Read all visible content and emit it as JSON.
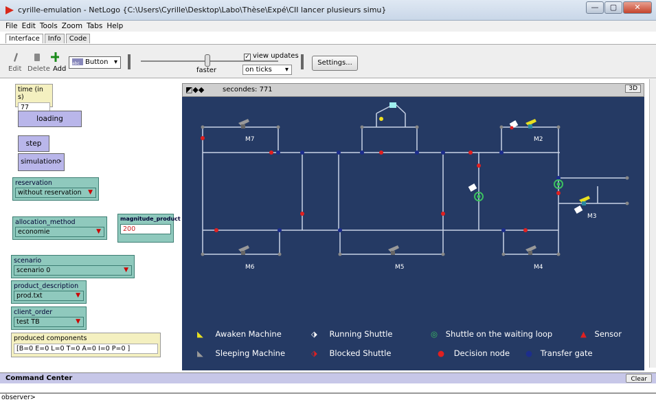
{
  "window": {
    "title": "cyrille-emulation - NetLogo {C:\\Users\\Cyrille\\Desktop\\Labo\\Thèse\\Expé\\CII lancer plusieurs simu}",
    "buttons": [
      "—",
      "▢",
      "✕"
    ]
  },
  "menu": [
    "File",
    "Edit",
    "Tools",
    "Zoom",
    "Tabs",
    "Help"
  ],
  "tabs": [
    "Interface",
    "Info",
    "Code"
  ],
  "toolbar": {
    "edit": "Edit",
    "delete": "Delete",
    "add": "Add",
    "widget_type": "Button",
    "speed_label": "faster",
    "view_updates": "view updates",
    "update_mode": "on ticks",
    "settings": "Settings..."
  },
  "widgets": {
    "time_label": "time (in s)",
    "time_value": "77",
    "loading": "loading",
    "step": "step",
    "simulation": "simulation",
    "reservation_label": "reservation",
    "reservation_value": "without reservation",
    "allocation_label": "allocation_method",
    "allocation_value": "economie",
    "magnitude_label": "magnitude_product",
    "magnitude_value": "200",
    "scenario_label": "scenario",
    "scenario_value": "scenario 0",
    "product_label": "product_description",
    "product_value": "prod.txt",
    "client_label": "client_order",
    "client_value": "test TB",
    "produced_label": "produced components",
    "produced_value": "[B=0  E=0  L=0  T=0  A=0  I=0  P=0 ]"
  },
  "view": {
    "ticks_label": "secondes: 771",
    "three_d": "3D",
    "machines": [
      "M7",
      "M2",
      "M3",
      "M6",
      "M5",
      "M4"
    ],
    "legend": {
      "awaken": "Awaken Machine",
      "running": "Running Shuttle",
      "waiting": "Shuttle on the waiting loop",
      "sensor": "Sensor",
      "sleeping": "Sleeping Machine",
      "blocked": "Blocked Shuttle",
      "decision": "Decision node",
      "transfer": "Transfer gate"
    }
  },
  "command_center": {
    "title": "Command Center",
    "clear": "Clear",
    "prompt": "observer>"
  },
  "colors": {
    "view_bg": "#253a64",
    "chooser": "#8fc9bd",
    "button": "#b9b6ea",
    "track": "#c9d3e6",
    "decision": "#e02020",
    "transfer": "#1c2d8c"
  }
}
